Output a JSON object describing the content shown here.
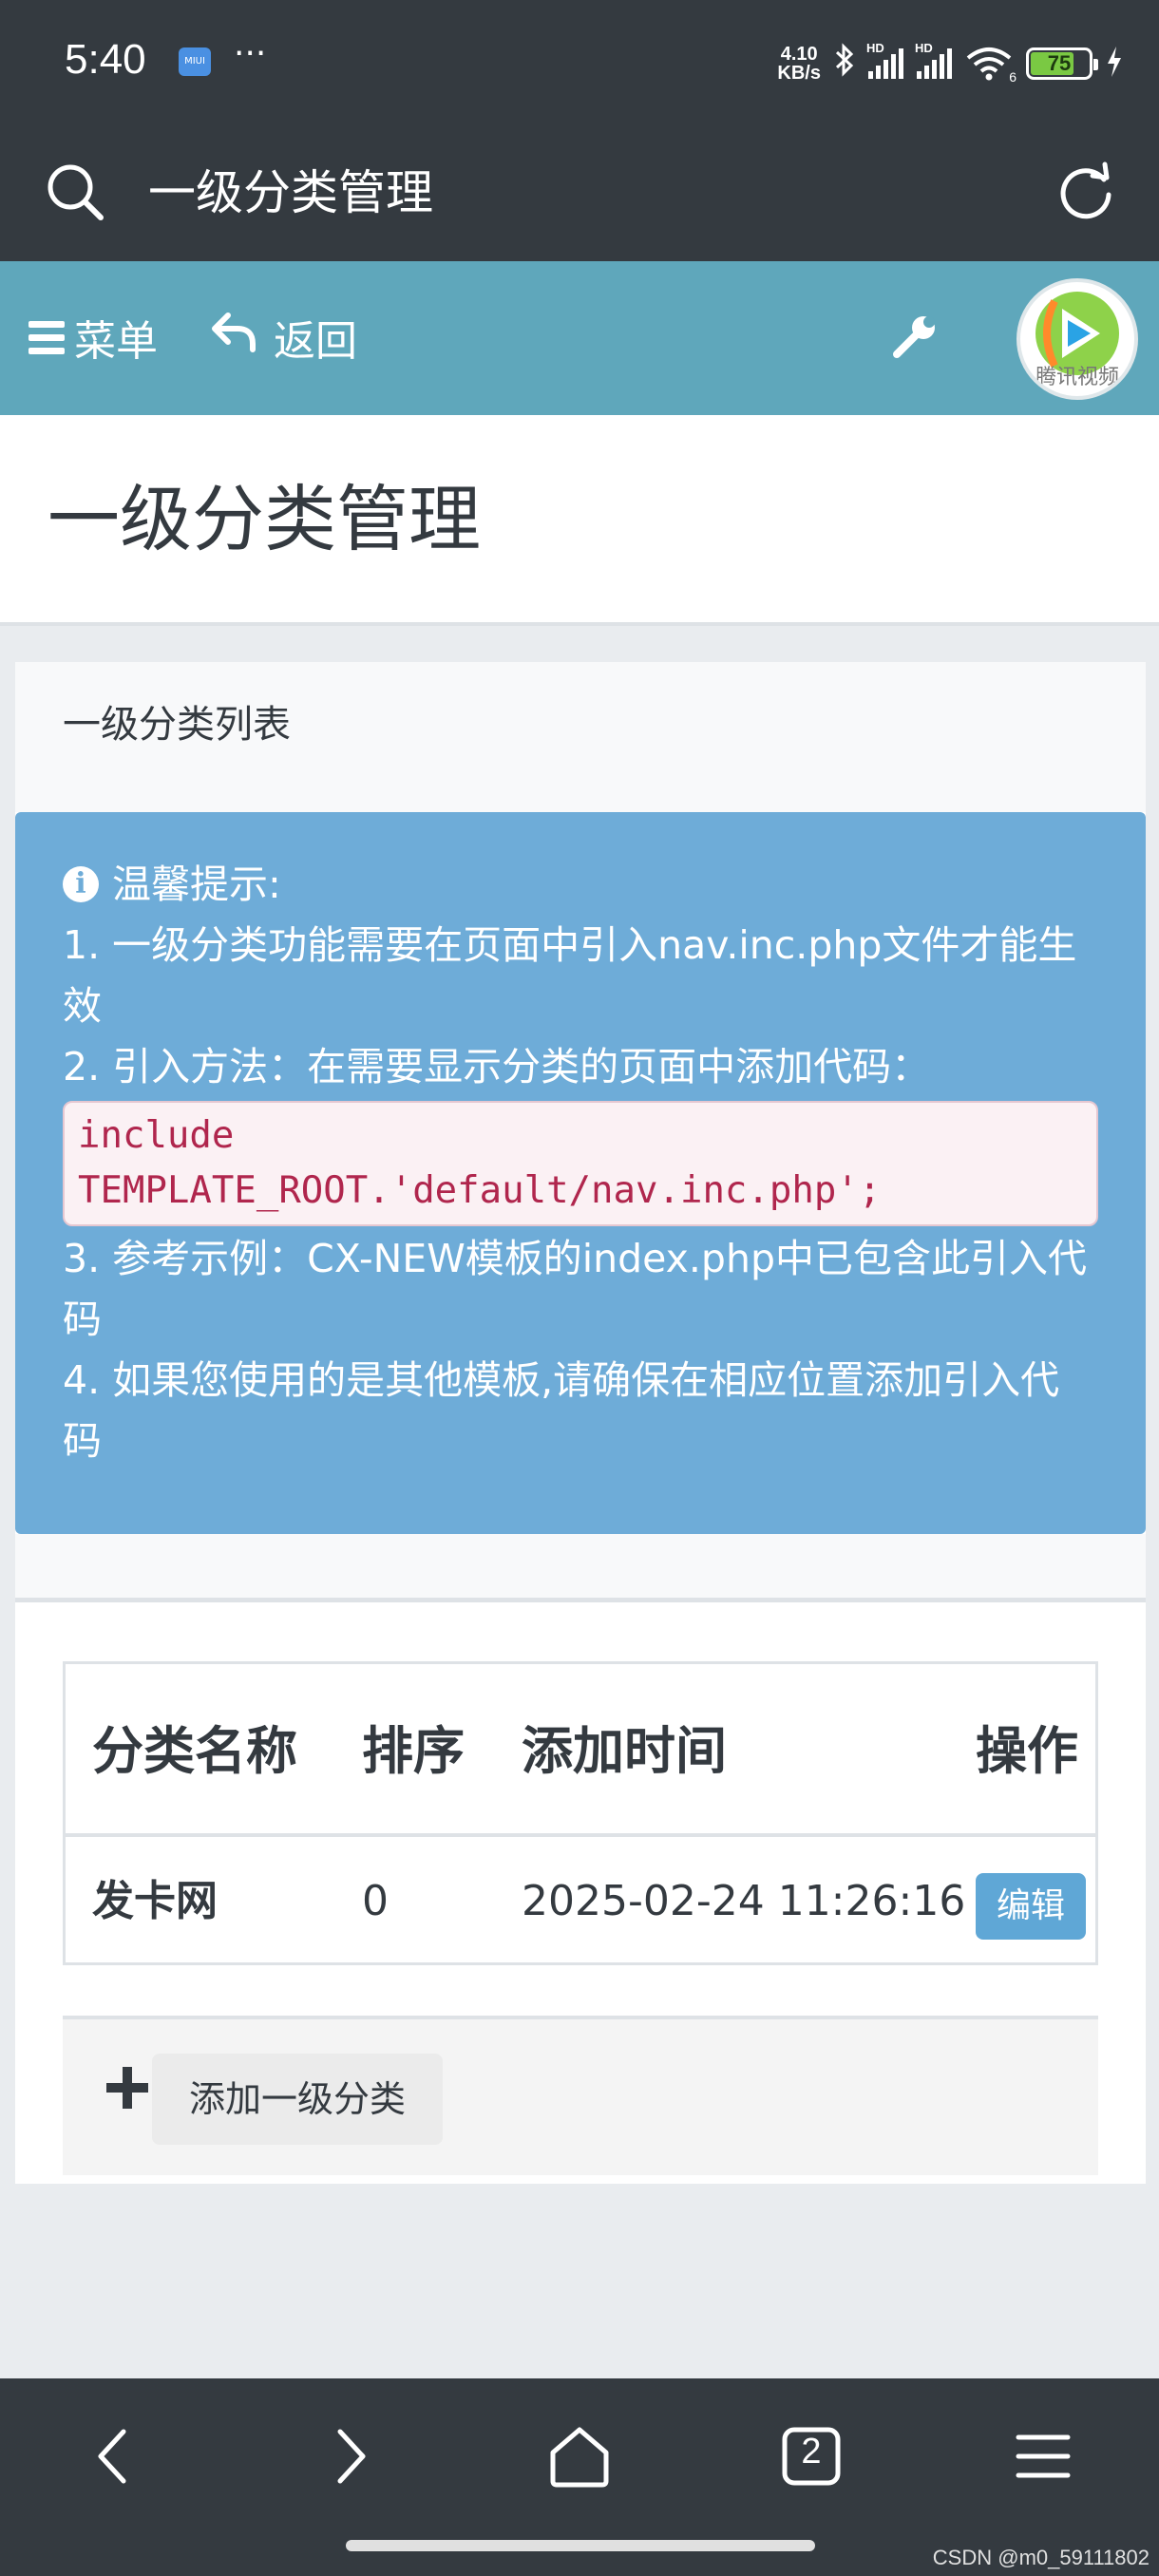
{
  "status_bar": {
    "time": "5:40",
    "mi_label": "MIUI",
    "more": "···",
    "net_speed_value": "4.10",
    "net_speed_unit": "KB/s",
    "sim1_label": "HD",
    "sim2_label": "HD",
    "wifi_label": "6",
    "battery": "75",
    "battery_level": 0.75
  },
  "browser": {
    "title": "一级分类管理"
  },
  "nav": {
    "menu_label": "菜单",
    "back_label": "返回",
    "avatar_label": "腾讯视频"
  },
  "page": {
    "title": "一级分类管理"
  },
  "card": {
    "header": "一级分类列表",
    "tip": {
      "title": "温馨提示:",
      "line1": "1. 一级分类功能需要在页面中引入nav.inc.php文件才能生效",
      "line2": "2. 引入方法：在需要显示分类的页面中添加代码：",
      "code_line1": "include",
      "code_line2": "TEMPLATE_ROOT.'default/nav.inc.php';",
      "line3": "3. 参考示例：CX-NEW模板的index.php中已包含此引入代码",
      "line4": "4. 如果您使用的是其他模板,请确保在相应位置添加引入代码"
    },
    "table": {
      "headers": [
        "分类名称",
        "排序",
        "添加时间",
        "操作"
      ],
      "rows": [
        {
          "name": "发卡网",
          "sort": "0",
          "time": "2025-02-24 11:26:16",
          "action": "编辑"
        }
      ]
    },
    "add_button": "添加一级分类"
  },
  "bottom_bar": {
    "tab_count": "2",
    "watermark": "CSDN @m0_59111802"
  },
  "colors": {
    "dark_bar": "#343a40",
    "nav_teal": "#5fa7bb",
    "tip_blue": "#6eacd8",
    "code_red": "#b0264d",
    "edit_blue": "#5fa7d6"
  }
}
